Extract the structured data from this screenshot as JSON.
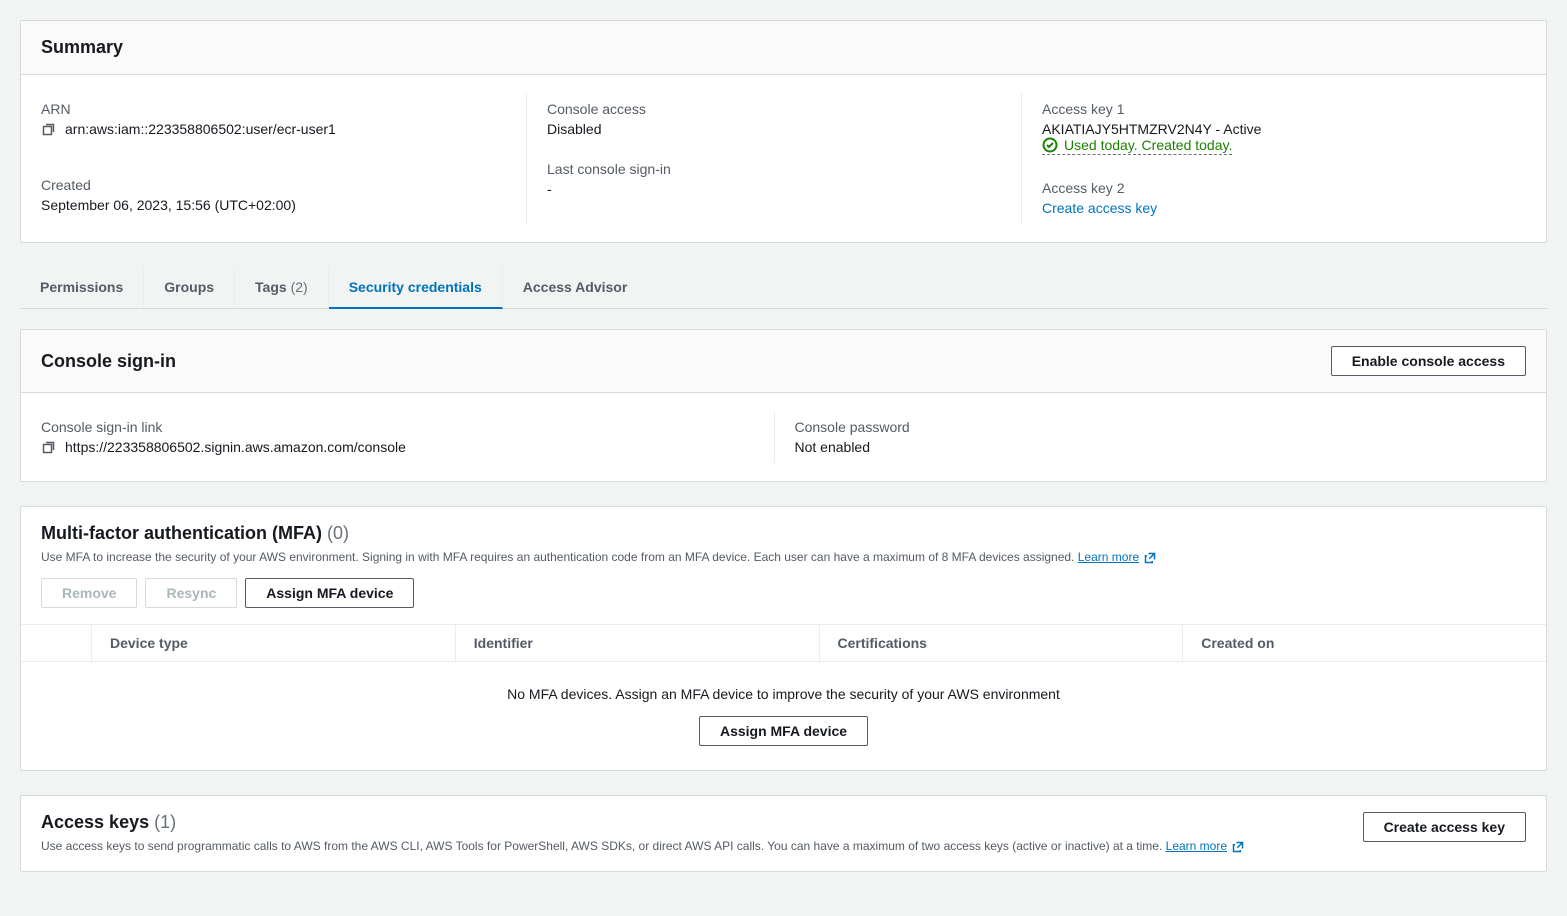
{
  "summary": {
    "title": "Summary",
    "arn_label": "ARN",
    "arn_value": "arn:aws:iam::223358806502:user/ecr-user1",
    "console_access_label": "Console access",
    "console_access_value": "Disabled",
    "access_key1_label": "Access key 1",
    "access_key1_value": "AKIATIAJY5HTMZRV2N4Y - Active",
    "access_key1_status": "Used today. Created today.",
    "created_label": "Created",
    "created_value": "September 06, 2023, 15:56 (UTC+02:00)",
    "last_signin_label": "Last console sign-in",
    "last_signin_value": "-",
    "access_key2_label": "Access key 2",
    "create_access_key_link": "Create access key"
  },
  "tabs": {
    "permissions": "Permissions",
    "groups": "Groups",
    "tags": "Tags",
    "tags_count": "(2)",
    "security": "Security credentials",
    "advisor": "Access Advisor"
  },
  "console_signin": {
    "title": "Console sign-in",
    "enable_button": "Enable console access",
    "link_label": "Console sign-in link",
    "link_value": "https://223358806502.signin.aws.amazon.com/console",
    "password_label": "Console password",
    "password_value": "Not enabled"
  },
  "mfa": {
    "title": "Multi-factor authentication (MFA)",
    "count": "(0)",
    "desc": "Use MFA to increase the security of your AWS environment. Signing in with MFA requires an authentication code from an MFA device. Each user can have a maximum of 8 MFA devices assigned.",
    "learn_more": "Learn more",
    "remove_btn": "Remove",
    "resync_btn": "Resync",
    "assign_btn": "Assign MFA device",
    "th_device_type": "Device type",
    "th_identifier": "Identifier",
    "th_certifications": "Certifications",
    "th_created_on": "Created on",
    "empty_msg": "No MFA devices. Assign an MFA device to improve the security of your AWS environment",
    "empty_btn": "Assign MFA device"
  },
  "access_keys": {
    "title": "Access keys",
    "count": "(1)",
    "create_btn": "Create access key",
    "desc": "Use access keys to send programmatic calls to AWS from the AWS CLI, AWS Tools for PowerShell, AWS SDKs, or direct AWS API calls. You can have a maximum of two access keys (active or inactive) at a time.",
    "learn_more": "Learn more"
  }
}
